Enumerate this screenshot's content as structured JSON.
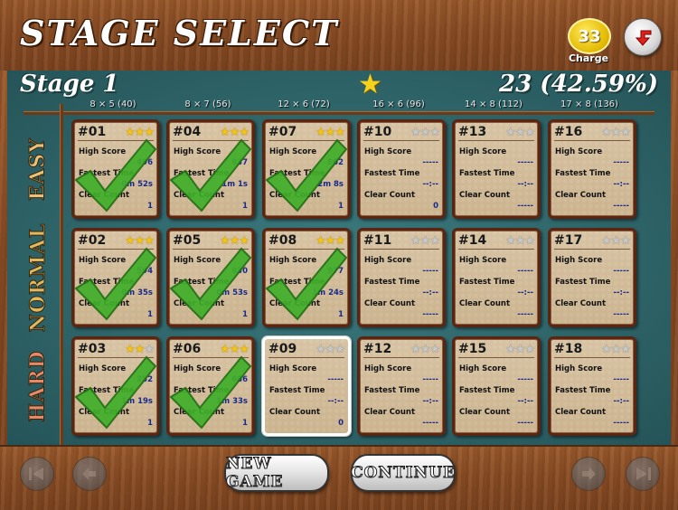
{
  "header": {
    "title": "STAGE SELECT",
    "charge_count": "33",
    "charge_label": "Charge",
    "back_icon": "return-arrow-icon"
  },
  "stage": {
    "title": "Stage 1",
    "star_icon": "star-icon",
    "score": "23 (42.59%)"
  },
  "columns": [
    "8 × 5 (40)",
    "8 × 7 (56)",
    "12 × 6 (72)",
    "16 × 6 (96)",
    "14 × 8 (112)",
    "17 × 8 (136)"
  ],
  "rows": [
    {
      "label": "EASY",
      "color": "#e8c27a"
    },
    {
      "label": "NORMAL",
      "color": "#e0b860"
    },
    {
      "label": "HARD",
      "color": "#e88a6a"
    }
  ],
  "field_labels": {
    "high_score": "High Score",
    "fastest_time": "Fastest Time",
    "clear_count": "Clear Count"
  },
  "cards": [
    [
      {
        "num": "#01",
        "stars": 3,
        "high_score": "496",
        "fastest_time": "0m 52s",
        "clear_count": "1",
        "cleared": true,
        "selected": false
      },
      {
        "num": "#04",
        "stars": 3,
        "high_score": "837",
        "fastest_time": "1m 1s",
        "clear_count": "1",
        "cleared": true,
        "selected": false
      },
      {
        "num": "#07",
        "stars": 3,
        "high_score": "862",
        "fastest_time": "2m 8s",
        "clear_count": "1",
        "cleared": true,
        "selected": false
      },
      {
        "num": "#10",
        "stars": 0,
        "high_score": "-----",
        "fastest_time": "--:--",
        "clear_count": "0",
        "cleared": false,
        "selected": false
      },
      {
        "num": "#13",
        "stars": 0,
        "high_score": "-----",
        "fastest_time": "--:--",
        "clear_count": "-----",
        "cleared": false,
        "selected": false
      },
      {
        "num": "#16",
        "stars": 0,
        "high_score": "-----",
        "fastest_time": "--:--",
        "clear_count": "-----",
        "cleared": false,
        "selected": false
      }
    ],
    [
      {
        "num": "#02",
        "stars": 3,
        "high_score": "594",
        "fastest_time": "0m 35s",
        "clear_count": "1",
        "cleared": true,
        "selected": false
      },
      {
        "num": "#05",
        "stars": 3,
        "high_score": "830",
        "fastest_time": "0m 53s",
        "clear_count": "1",
        "cleared": true,
        "selected": false
      },
      {
        "num": "#08",
        "stars": 3,
        "high_score": "977",
        "fastest_time": "1m 24s",
        "clear_count": "1",
        "cleared": true,
        "selected": false
      },
      {
        "num": "#11",
        "stars": 0,
        "high_score": "-----",
        "fastest_time": "--:--",
        "clear_count": "-----",
        "cleared": false,
        "selected": false
      },
      {
        "num": "#14",
        "stars": 0,
        "high_score": "-----",
        "fastest_time": "--:--",
        "clear_count": "-----",
        "cleared": false,
        "selected": false
      },
      {
        "num": "#17",
        "stars": 0,
        "high_score": "-----",
        "fastest_time": "--:--",
        "clear_count": "-----",
        "cleared": false,
        "selected": false
      }
    ],
    [
      {
        "num": "#03",
        "stars": 2,
        "high_score": "252",
        "fastest_time": "1m 19s",
        "clear_count": "1",
        "cleared": true,
        "selected": false
      },
      {
        "num": "#06",
        "stars": 3,
        "high_score": "686",
        "fastest_time": "1m 33s",
        "clear_count": "1",
        "cleared": true,
        "selected": false
      },
      {
        "num": "#09",
        "stars": 0,
        "high_score": "-----",
        "fastest_time": "--:--",
        "clear_count": "0",
        "cleared": false,
        "selected": true
      },
      {
        "num": "#12",
        "stars": 0,
        "high_score": "-----",
        "fastest_time": "--:--",
        "clear_count": "-----",
        "cleared": false,
        "selected": false
      },
      {
        "num": "#15",
        "stars": 0,
        "high_score": "-----",
        "fastest_time": "--:--",
        "clear_count": "-----",
        "cleared": false,
        "selected": false
      },
      {
        "num": "#18",
        "stars": 0,
        "high_score": "-----",
        "fastest_time": "--:--",
        "clear_count": "-----",
        "cleared": false,
        "selected": false
      }
    ]
  ],
  "footer": {
    "new_game_label": "NEW GAME",
    "continue_label": "CONTINUE",
    "first_icon": "skip-first-icon",
    "prev_icon": "previous-icon",
    "next_icon": "next-icon",
    "last_icon": "skip-last-icon"
  }
}
